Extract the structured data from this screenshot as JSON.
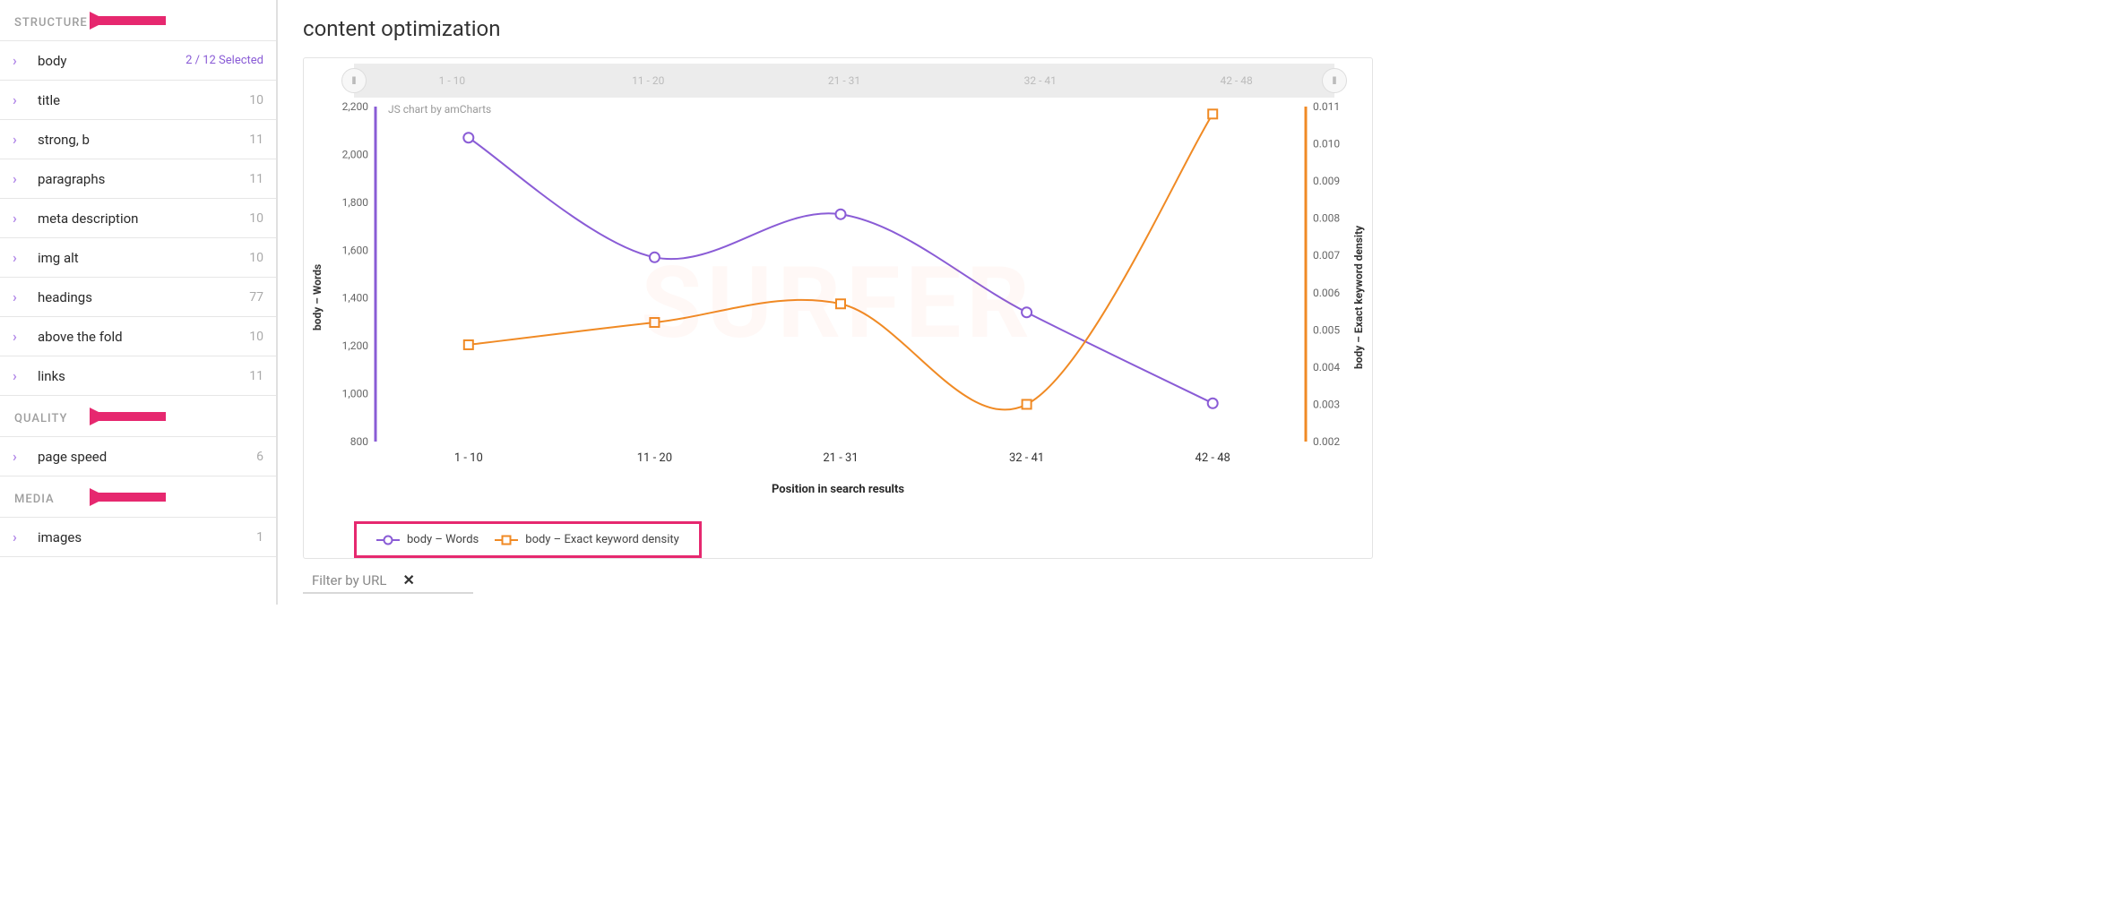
{
  "sidebar": {
    "sections": [
      {
        "title": "STRUCTURE",
        "items": [
          {
            "label": "body",
            "selected_text": "2 / 12 Selected",
            "count": null
          },
          {
            "label": "title",
            "count": 10
          },
          {
            "label": "strong, b",
            "count": 11
          },
          {
            "label": "paragraphs",
            "count": 11
          },
          {
            "label": "meta description",
            "count": 10
          },
          {
            "label": "img alt",
            "count": 10
          },
          {
            "label": "headings",
            "count": 77
          },
          {
            "label": "above the fold",
            "count": 10
          },
          {
            "label": "links",
            "count": 11
          }
        ]
      },
      {
        "title": "QUALITY",
        "items": [
          {
            "label": "page speed",
            "count": 6
          }
        ]
      },
      {
        "title": "MEDIA",
        "items": [
          {
            "label": "images",
            "count": 1
          }
        ]
      }
    ]
  },
  "main": {
    "title": "content optimization",
    "chart_credit": "JS chart by amCharts",
    "filter_placeholder": "Filter by URL",
    "watermark_text": "SURFER"
  },
  "chart_data": {
    "type": "line",
    "categories": [
      "1 - 10",
      "11 - 20",
      "21 - 31",
      "32 - 41",
      "42 - 48"
    ],
    "series": [
      {
        "name": "body – Words",
        "axis": "left",
        "color": "#8a5cd6",
        "marker": "circle",
        "values": [
          2070,
          1570,
          1750,
          1340,
          960
        ]
      },
      {
        "name": "body – Exact keyword density",
        "axis": "right",
        "color": "#f08a24",
        "marker": "square",
        "values": [
          0.0046,
          0.0052,
          0.0057,
          0.003,
          0.0108
        ]
      }
    ],
    "xlabel": "Position in search results",
    "y_left": {
      "label": "body – Words",
      "min": 800,
      "max": 2200,
      "ticks": [
        800,
        1000,
        1200,
        1400,
        1600,
        1800,
        2000,
        2200
      ]
    },
    "y_right": {
      "label": "body – Exact keyword density",
      "min": 0.002,
      "max": 0.011,
      "ticks": [
        0.002,
        0.003,
        0.004,
        0.005,
        0.006,
        0.007,
        0.008,
        0.009,
        0.01,
        0.011
      ]
    }
  },
  "annotations": {
    "arrows_on_sections": true,
    "legend_highlight": true,
    "arrow_color": "#e6286f"
  }
}
